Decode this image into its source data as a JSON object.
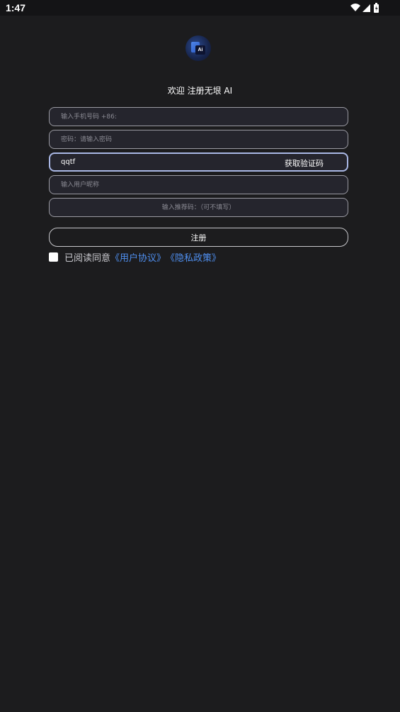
{
  "status_bar": {
    "time": "1:47",
    "icons": [
      "wifi-icon",
      "cell-signal-icon",
      "battery-icon"
    ]
  },
  "logo": {
    "badge_text": "Ai"
  },
  "welcome_text": "欢迎 注册无垠 AI",
  "form": {
    "phone": {
      "placeholder": "输入手机号码 +86:",
      "value": ""
    },
    "password": {
      "placeholder": "密码：请输入密码",
      "value": ""
    },
    "verification": {
      "value": "qqtf",
      "button_label": "获取验证码"
    },
    "nickname": {
      "placeholder": "输入用户昵称",
      "value": ""
    },
    "referral": {
      "placeholder": "输入推荐码：（可不填写）",
      "value": ""
    },
    "register_label": "注册"
  },
  "agreement": {
    "prefix": "已阅读同意",
    "user_agreement": "《用户协议》",
    "privacy_policy": "《隐私政策》",
    "checked": false
  },
  "colors": {
    "background": "#1c1c1e",
    "field_bg": "#25252d",
    "link": "#4f8ff0",
    "focus_border": "#aab8e6"
  }
}
